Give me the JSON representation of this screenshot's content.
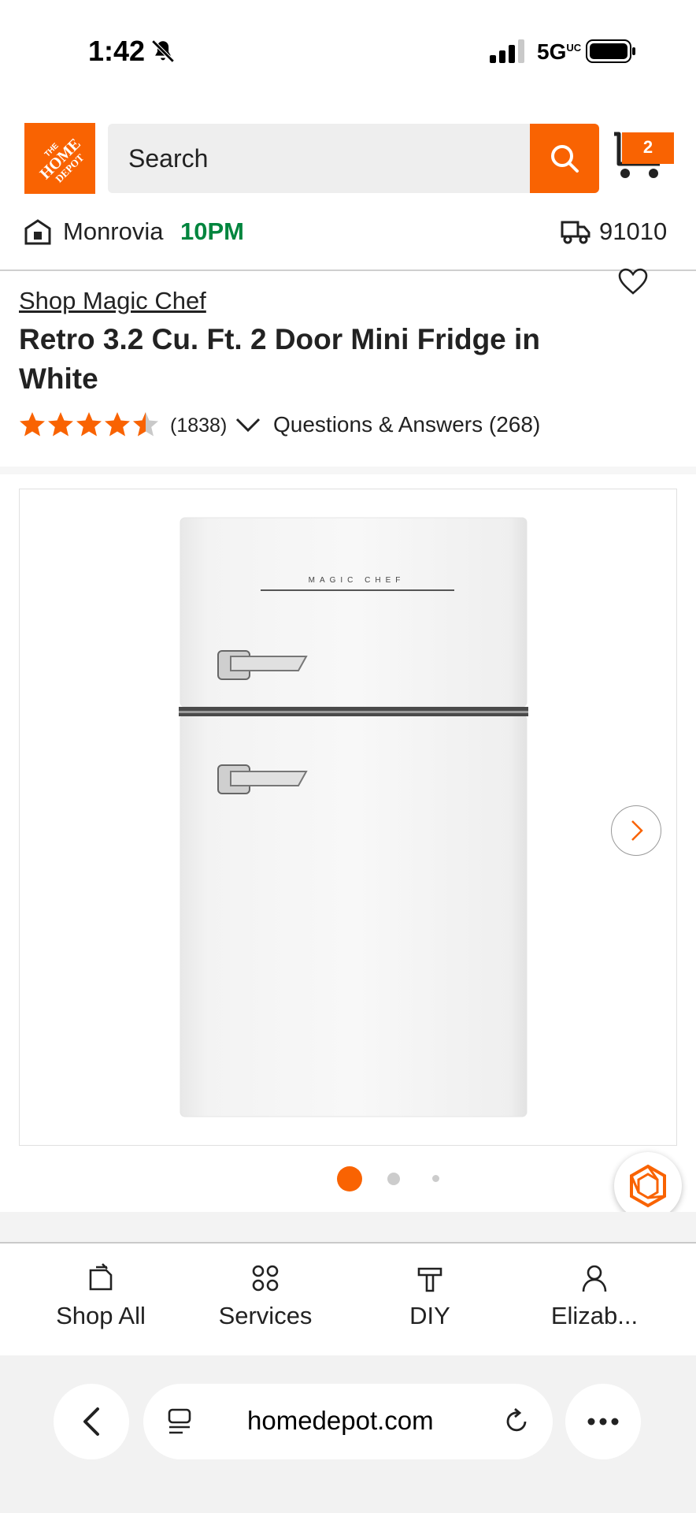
{
  "status_bar": {
    "time": "1:42",
    "network": "5G",
    "network_suffix": "UC"
  },
  "header": {
    "logo_text": "THE HOME DEPOT",
    "search_placeholder": "Search",
    "cart_count": "2"
  },
  "store": {
    "name": "Monrovia",
    "hours": "10PM",
    "zip": "91010"
  },
  "product": {
    "brand_link": "Shop Magic Chef",
    "title": "Retro 3.2 Cu. Ft. 2 Door Mini Fridge in White",
    "rating": 4.5,
    "review_count": "(1838)",
    "qa_label": "Questions & Answers (268)",
    "image_brand_text": "MAGIC CHEF",
    "image_index": 1,
    "image_total": 3
  },
  "bottom_nav": {
    "items": [
      {
        "label": "Shop All",
        "icon": "shop-all-icon"
      },
      {
        "label": "Services",
        "icon": "services-icon"
      },
      {
        "label": "DIY",
        "icon": "diy-icon"
      },
      {
        "label": "Elizab...",
        "icon": "account-icon"
      }
    ]
  },
  "browser": {
    "url": "homedepot.com"
  },
  "colors": {
    "brand_orange": "#f96302",
    "open_green": "#00853e"
  }
}
